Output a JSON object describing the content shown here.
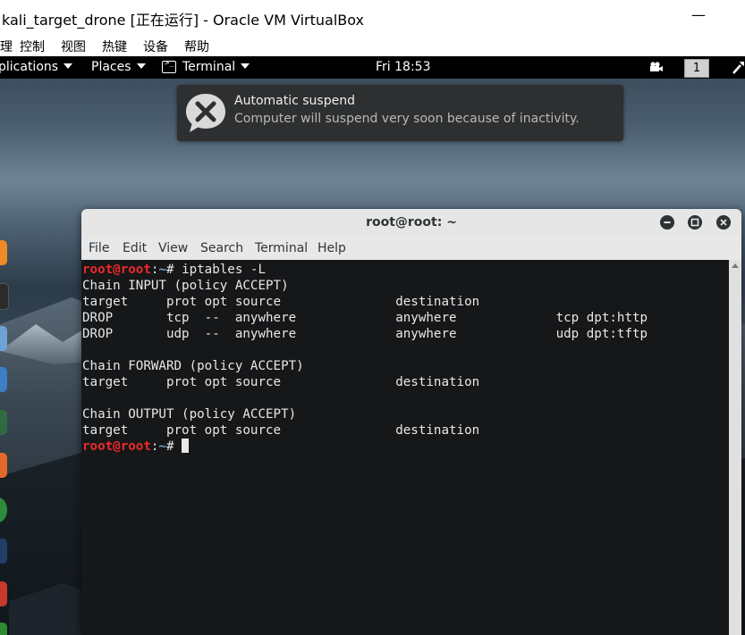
{
  "host": {
    "window_title": "kali_target_drone [正在运行] - Oracle VM VirtualBox",
    "minimize_label": "—",
    "menu": [
      "理",
      "控制",
      "视图",
      "热键",
      "设备",
      "帮助"
    ]
  },
  "panel": {
    "applications": "plications",
    "places": "Places",
    "terminal": "Terminal",
    "clock": "Fri 18:53",
    "workspace": "1"
  },
  "notification": {
    "title": "Automatic suspend",
    "body": "Computer will suspend very soon because of inactivity."
  },
  "terminal": {
    "title": "root@root: ~",
    "menu": [
      "File",
      "Edit",
      "View",
      "Search",
      "Terminal",
      "Help"
    ],
    "prompt_user": "root@root",
    "prompt_sep": ":",
    "prompt_path": "~",
    "prompt_symbol": "# ",
    "command": "iptables -L",
    "output": [
      "Chain INPUT (policy ACCEPT)",
      "target     prot opt source               destination",
      "DROP       tcp  --  anywhere             anywhere             tcp dpt:http",
      "DROP       udp  --  anywhere             anywhere             udp dpt:tftp",
      "",
      "Chain FORWARD (policy ACCEPT)",
      "target     prot opt source               destination",
      "",
      "Chain OUTPUT (policy ACCEPT)",
      "target     prot opt source               destination"
    ]
  },
  "colors": {
    "prompt_user": "#ef2929",
    "prompt_path": "#729fcf",
    "panel_bg": "#000000",
    "notification_bg": "#2d2f31"
  },
  "icons": [
    "terminal-icon",
    "camera-icon",
    "tool-icon",
    "suspend-icon",
    "close-icon",
    "minimize-icon",
    "maximize-icon"
  ]
}
